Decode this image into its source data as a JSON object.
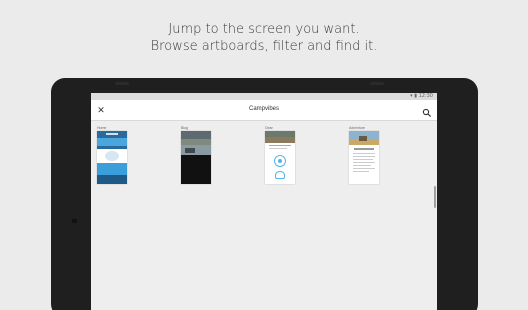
{
  "headline": {
    "line1": "Jump to the screen you want.",
    "line2": "Browse artboards, filter and find it."
  },
  "status": {
    "time": "12:30"
  },
  "appbar": {
    "title": "Campvibes",
    "close_icon": "close-icon",
    "search_icon": "search-icon"
  },
  "artboards": [
    {
      "label": "Home"
    },
    {
      "label": "Blog"
    },
    {
      "label": "Gear"
    },
    {
      "label": "Adventure"
    }
  ],
  "colors": {
    "background": "#ebebeb",
    "device": "#1f1f1f",
    "accent_blue": "#3aa0d8"
  }
}
